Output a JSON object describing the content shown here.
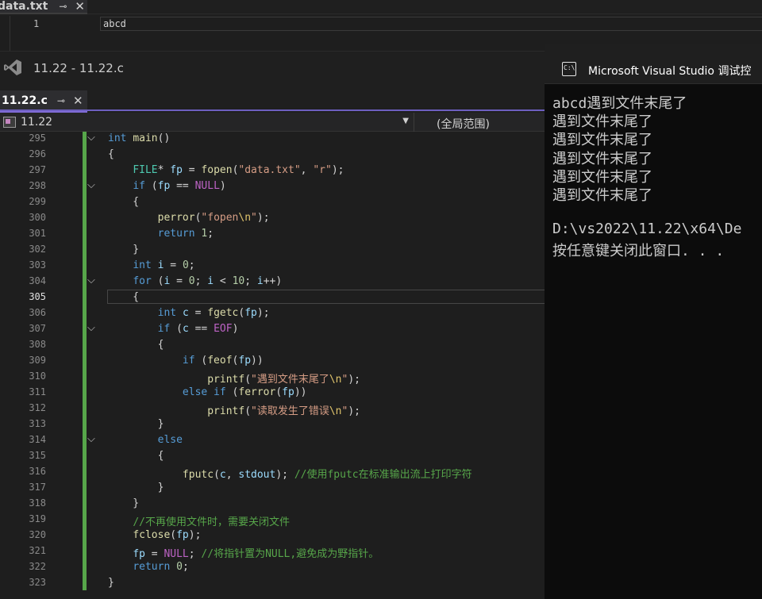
{
  "top_file": {
    "tab_label": "data.txt",
    "pin_icon": "pin-icon",
    "close_icon": "close-icon",
    "line_number": "1",
    "content": "abcd"
  },
  "window": {
    "title": "11.22 - 11.22.c"
  },
  "document_tab": {
    "label": "11.22.c",
    "accent_color": "#6d5fbf"
  },
  "navbar": {
    "project": "11.22",
    "scope": "(全局范围)"
  },
  "editor": {
    "current_line": "305",
    "change_bar_color": "#57a64a",
    "lines": [
      {
        "n": "295",
        "fold": "⌵",
        "code": [
          [
            "kw",
            "int"
          ],
          [
            "plain",
            " "
          ],
          [
            "fn",
            "main"
          ],
          [
            "plain",
            "()"
          ]
        ]
      },
      {
        "n": "296",
        "code": [
          [
            "plain",
            "{"
          ]
        ]
      },
      {
        "n": "297",
        "code": [
          [
            "plain",
            "    "
          ],
          [
            "type",
            "FILE"
          ],
          [
            "plain",
            "* "
          ],
          [
            "var",
            "fp"
          ],
          [
            "plain",
            " = "
          ],
          [
            "fn",
            "fopen"
          ],
          [
            "plain",
            "("
          ],
          [
            "str",
            "\"data.txt\""
          ],
          [
            "plain",
            ", "
          ],
          [
            "str",
            "\"r\""
          ],
          [
            "plain",
            ");"
          ]
        ]
      },
      {
        "n": "298",
        "fold": "⌵",
        "code": [
          [
            "plain",
            "    "
          ],
          [
            "kw",
            "if"
          ],
          [
            "plain",
            " ("
          ],
          [
            "var",
            "fp"
          ],
          [
            "plain",
            " == "
          ],
          [
            "mac",
            "NULL"
          ],
          [
            "plain",
            ")"
          ]
        ]
      },
      {
        "n": "299",
        "code": [
          [
            "plain",
            "    {"
          ]
        ]
      },
      {
        "n": "300",
        "code": [
          [
            "plain",
            "        "
          ],
          [
            "fn",
            "perror"
          ],
          [
            "plain",
            "("
          ],
          [
            "str",
            "\"fopen"
          ],
          [
            "esc",
            "\\n"
          ],
          [
            "str",
            "\""
          ],
          [
            "plain",
            ");"
          ]
        ]
      },
      {
        "n": "301",
        "code": [
          [
            "plain",
            "        "
          ],
          [
            "kw",
            "return"
          ],
          [
            "plain",
            " "
          ],
          [
            "num",
            "1"
          ],
          [
            "plain",
            ";"
          ]
        ]
      },
      {
        "n": "302",
        "code": [
          [
            "plain",
            "    }"
          ]
        ]
      },
      {
        "n": "303",
        "code": [
          [
            "plain",
            "    "
          ],
          [
            "kw",
            "int"
          ],
          [
            "plain",
            " "
          ],
          [
            "var",
            "i"
          ],
          [
            "plain",
            " = "
          ],
          [
            "num",
            "0"
          ],
          [
            "plain",
            ";"
          ]
        ]
      },
      {
        "n": "304",
        "fold": "⌵",
        "code": [
          [
            "plain",
            "    "
          ],
          [
            "kw",
            "for"
          ],
          [
            "plain",
            " ("
          ],
          [
            "var",
            "i"
          ],
          [
            "plain",
            " = "
          ],
          [
            "num",
            "0"
          ],
          [
            "plain",
            "; "
          ],
          [
            "var",
            "i"
          ],
          [
            "plain",
            " < "
          ],
          [
            "num",
            "10"
          ],
          [
            "plain",
            "; "
          ],
          [
            "var",
            "i"
          ],
          [
            "plain",
            "++)"
          ]
        ]
      },
      {
        "n": "305",
        "code": [
          [
            "plain",
            "    {"
          ]
        ]
      },
      {
        "n": "306",
        "code": [
          [
            "plain",
            "        "
          ],
          [
            "kw",
            "int"
          ],
          [
            "plain",
            " "
          ],
          [
            "var",
            "c"
          ],
          [
            "plain",
            " = "
          ],
          [
            "fn",
            "fgetc"
          ],
          [
            "plain",
            "("
          ],
          [
            "var",
            "fp"
          ],
          [
            "plain",
            ");"
          ]
        ]
      },
      {
        "n": "307",
        "fold": "⌵",
        "code": [
          [
            "plain",
            "        "
          ],
          [
            "kw",
            "if"
          ],
          [
            "plain",
            " ("
          ],
          [
            "var",
            "c"
          ],
          [
            "plain",
            " == "
          ],
          [
            "mac",
            "EOF"
          ],
          [
            "plain",
            ")"
          ]
        ]
      },
      {
        "n": "308",
        "code": [
          [
            "plain",
            "        {"
          ]
        ]
      },
      {
        "n": "309",
        "code": [
          [
            "plain",
            "            "
          ],
          [
            "kw",
            "if"
          ],
          [
            "plain",
            " ("
          ],
          [
            "fn",
            "feof"
          ],
          [
            "plain",
            "("
          ],
          [
            "var",
            "fp"
          ],
          [
            "plain",
            "))"
          ]
        ]
      },
      {
        "n": "310",
        "code": [
          [
            "plain",
            "                "
          ],
          [
            "fn",
            "printf"
          ],
          [
            "plain",
            "("
          ],
          [
            "str",
            "\"遇到文件末尾了"
          ],
          [
            "esc",
            "\\n"
          ],
          [
            "str",
            "\""
          ],
          [
            "plain",
            ");"
          ]
        ]
      },
      {
        "n": "311",
        "code": [
          [
            "plain",
            "            "
          ],
          [
            "kw",
            "else if"
          ],
          [
            "plain",
            " ("
          ],
          [
            "fn",
            "ferror"
          ],
          [
            "plain",
            "("
          ],
          [
            "var",
            "fp"
          ],
          [
            "plain",
            "))"
          ]
        ]
      },
      {
        "n": "312",
        "code": [
          [
            "plain",
            "                "
          ],
          [
            "fn",
            "printf"
          ],
          [
            "plain",
            "("
          ],
          [
            "str",
            "\"读取发生了错误"
          ],
          [
            "esc",
            "\\n"
          ],
          [
            "str",
            "\""
          ],
          [
            "plain",
            ");"
          ]
        ]
      },
      {
        "n": "313",
        "code": [
          [
            "plain",
            "        }"
          ]
        ]
      },
      {
        "n": "314",
        "fold": "⌵",
        "code": [
          [
            "plain",
            "        "
          ],
          [
            "kw",
            "else"
          ]
        ]
      },
      {
        "n": "315",
        "code": [
          [
            "plain",
            "        {"
          ]
        ]
      },
      {
        "n": "316",
        "code": [
          [
            "plain",
            "            "
          ],
          [
            "fn",
            "fputc"
          ],
          [
            "plain",
            "("
          ],
          [
            "var",
            "c"
          ],
          [
            "plain",
            ", "
          ],
          [
            "var",
            "stdout"
          ],
          [
            "plain",
            "); "
          ],
          [
            "cmt",
            "//使用fputc在标准输出流上打印字符"
          ]
        ]
      },
      {
        "n": "317",
        "code": [
          [
            "plain",
            "        }"
          ]
        ]
      },
      {
        "n": "318",
        "code": [
          [
            "plain",
            "    }"
          ]
        ]
      },
      {
        "n": "319",
        "code": [
          [
            "plain",
            "    "
          ],
          [
            "cmt",
            "//不再使用文件时，需要关闭文件"
          ]
        ]
      },
      {
        "n": "320",
        "code": [
          [
            "plain",
            "    "
          ],
          [
            "fn",
            "fclose"
          ],
          [
            "plain",
            "("
          ],
          [
            "var",
            "fp"
          ],
          [
            "plain",
            ");"
          ]
        ]
      },
      {
        "n": "321",
        "code": [
          [
            "plain",
            "    "
          ],
          [
            "var",
            "fp"
          ],
          [
            "plain",
            " = "
          ],
          [
            "mac",
            "NULL"
          ],
          [
            "plain",
            "; "
          ],
          [
            "cmt",
            "//将指针置为NULL,避免成为野指针。"
          ]
        ]
      },
      {
        "n": "322",
        "code": [
          [
            "plain",
            "    "
          ],
          [
            "kw",
            "return"
          ],
          [
            "plain",
            " "
          ],
          [
            "num",
            "0"
          ],
          [
            "plain",
            ";"
          ]
        ]
      },
      {
        "n": "323",
        "code": [
          [
            "plain",
            "}"
          ]
        ]
      }
    ]
  },
  "console": {
    "title": "Microsoft Visual Studio 调试控",
    "icon": "cmd-icon",
    "output": [
      "abcd遇到文件末尾了",
      "遇到文件末尾了",
      "遇到文件末尾了",
      "遇到文件末尾了",
      "遇到文件末尾了",
      "遇到文件末尾了",
      "",
      "D:\\vs2022\\11.22\\x64\\De",
      "按任意键关闭此窗口. . ."
    ]
  }
}
